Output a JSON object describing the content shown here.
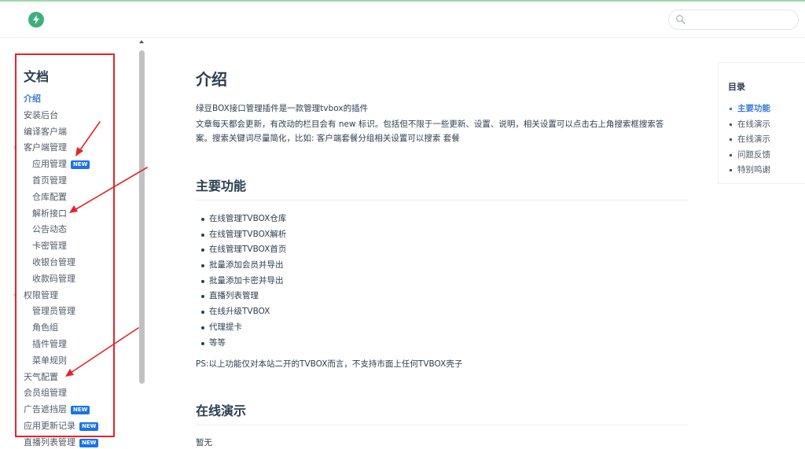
{
  "header": {
    "search_placeholder": ""
  },
  "sidebar": {
    "title": "文档",
    "badge_text": "NEW",
    "items": [
      {
        "label": "介绍",
        "level": 1,
        "active": true
      },
      {
        "label": "安装后台",
        "level": 1
      },
      {
        "label": "编译客户端",
        "level": 1
      },
      {
        "label": "客户端管理",
        "level": 1,
        "group": true
      },
      {
        "label": "应用管理",
        "level": 2,
        "badge": true
      },
      {
        "label": "首页管理",
        "level": 2
      },
      {
        "label": "仓库配置",
        "level": 2
      },
      {
        "label": "解析接口",
        "level": 2
      },
      {
        "label": "公告动态",
        "level": 2
      },
      {
        "label": "卡密管理",
        "level": 2
      },
      {
        "label": "收银台管理",
        "level": 2
      },
      {
        "label": "收款码管理",
        "level": 2
      },
      {
        "label": "权限管理",
        "level": 1,
        "group": true
      },
      {
        "label": "管理员管理",
        "level": 2
      },
      {
        "label": "角色组",
        "level": 2
      },
      {
        "label": "插件管理",
        "level": 2
      },
      {
        "label": "菜单规则",
        "level": 2
      },
      {
        "label": "天气配置",
        "level": 1
      },
      {
        "label": "会员组管理",
        "level": 1
      },
      {
        "label": "广告遮挡层",
        "level": 1,
        "badge": true
      },
      {
        "label": "应用更新记录",
        "level": 1,
        "badge": true
      },
      {
        "label": "直播列表管理",
        "level": 1,
        "badge": true
      }
    ]
  },
  "main": {
    "title": "介绍",
    "intro_line1": "绿豆BOX接口管理插件是一款管理tvbox的插件",
    "intro_line2": "文章每天都会更新，有改动的栏目会有 new 标识。包括但不限于一些更新、设置、说明，相关设置可以点击右上角搜索框搜索答",
    "intro_line3": "案。搜索关键词尽量简化，比如: 客户端套餐分组相关设置可以搜索 套餐",
    "section1_title": "主要功能",
    "features": [
      "在线管理TVBOX仓库",
      "在线管理TVBOX解析",
      "在线管理TVBOX首页",
      "批量添加会员并导出",
      "批量添加卡密并导出",
      "直播列表管理",
      "在线升级TVBOX",
      "代理提卡",
      "等等"
    ],
    "ps_note": "PS:以上功能仅对本站二开的TVBOX而言，不支持市面上任何TVBOX壳子",
    "section2_title": "在线演示",
    "demo_text": "暂无"
  },
  "toc": {
    "title": "目录",
    "items": [
      {
        "label": "主要功能",
        "active": true
      },
      {
        "label": "在线演示"
      },
      {
        "label": "在线演示"
      },
      {
        "label": "问题反馈"
      },
      {
        "label": "特别鸣谢"
      }
    ]
  },
  "colors": {
    "brand": "#3eaf7c",
    "link_active": "#3a7bd5",
    "badge": "#1a73e8",
    "annotation_red": "#e5242b"
  }
}
